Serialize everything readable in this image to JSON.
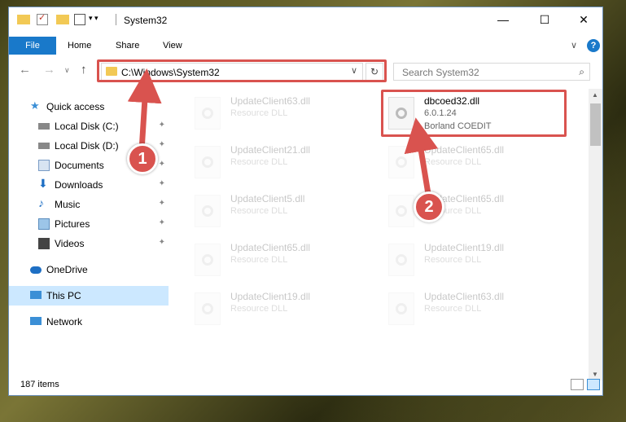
{
  "window": {
    "title": "System32",
    "controls": {
      "minimize": "—",
      "maximize": "☐",
      "close": "✕"
    }
  },
  "ribbon": {
    "tabs": [
      "File",
      "Home",
      "Share",
      "View"
    ],
    "collapse_glyph": "∨",
    "help_glyph": "?"
  },
  "navigation": {
    "back": "←",
    "forward": "→",
    "recent": "∨",
    "up": "↑",
    "address": "C:\\Windows\\System32",
    "address_dropdown": "∨",
    "refresh": "↻",
    "search_placeholder": "Search System32",
    "search_glyph": "⌕"
  },
  "sidebar": {
    "pin_glyph": "✦",
    "items": [
      {
        "label": "Quick access",
        "icon": "star-icon",
        "pinned": false
      },
      {
        "label": "Local Disk (C:)",
        "icon": "drive-icon",
        "pinned": true
      },
      {
        "label": "Local Disk (D:)",
        "icon": "drive-icon",
        "pinned": true
      },
      {
        "label": "Documents",
        "icon": "documents-icon",
        "pinned": true
      },
      {
        "label": "Downloads",
        "icon": "downloads-icon",
        "pinned": true
      },
      {
        "label": "Music",
        "icon": "music-icon",
        "pinned": true
      },
      {
        "label": "Pictures",
        "icon": "pictures-icon",
        "pinned": true
      },
      {
        "label": "Videos",
        "icon": "videos-icon",
        "pinned": true
      },
      {
        "label": "OneDrive",
        "icon": "cloud-icon",
        "pinned": false
      },
      {
        "label": "This PC",
        "icon": "pc-icon",
        "pinned": false,
        "selected": true
      },
      {
        "label": "Network",
        "icon": "network-icon",
        "pinned": false
      }
    ]
  },
  "files": [
    {
      "name": "UpdateClient63.dll",
      "type": "Resource DLL",
      "faded": true
    },
    {
      "name": "dbcoed32.dll",
      "type": "6.0.1.24",
      "company": "Borland COEDIT",
      "faded": false
    },
    {
      "name": "UpdateClient21.dll",
      "type": "Resource DLL",
      "faded": true
    },
    {
      "name": "UpdateClient65.dll",
      "type": "Resource DLL",
      "faded": true
    },
    {
      "name": "UpdateClient5.dll",
      "type": "Resource DLL",
      "faded": true
    },
    {
      "name": "UpdateClient65.dll",
      "type": "Resource DLL",
      "faded": true
    },
    {
      "name": "UpdateClient65.dll",
      "type": "Resource DLL",
      "faded": true
    },
    {
      "name": "UpdateClient19.dll",
      "type": "Resource DLL",
      "faded": true
    },
    {
      "name": "UpdateClient19.dll",
      "type": "Resource DLL",
      "faded": true
    },
    {
      "name": "UpdateClient63.dll",
      "type": "Resource DLL",
      "faded": true
    }
  ],
  "status": {
    "item_count": "187 items"
  },
  "annotations": {
    "step1": "1",
    "step2": "2",
    "color": "#d9534f"
  },
  "colors": {
    "file_tab": "#1979ca",
    "selection": "#cce8ff",
    "highlight": "#d9534f"
  }
}
